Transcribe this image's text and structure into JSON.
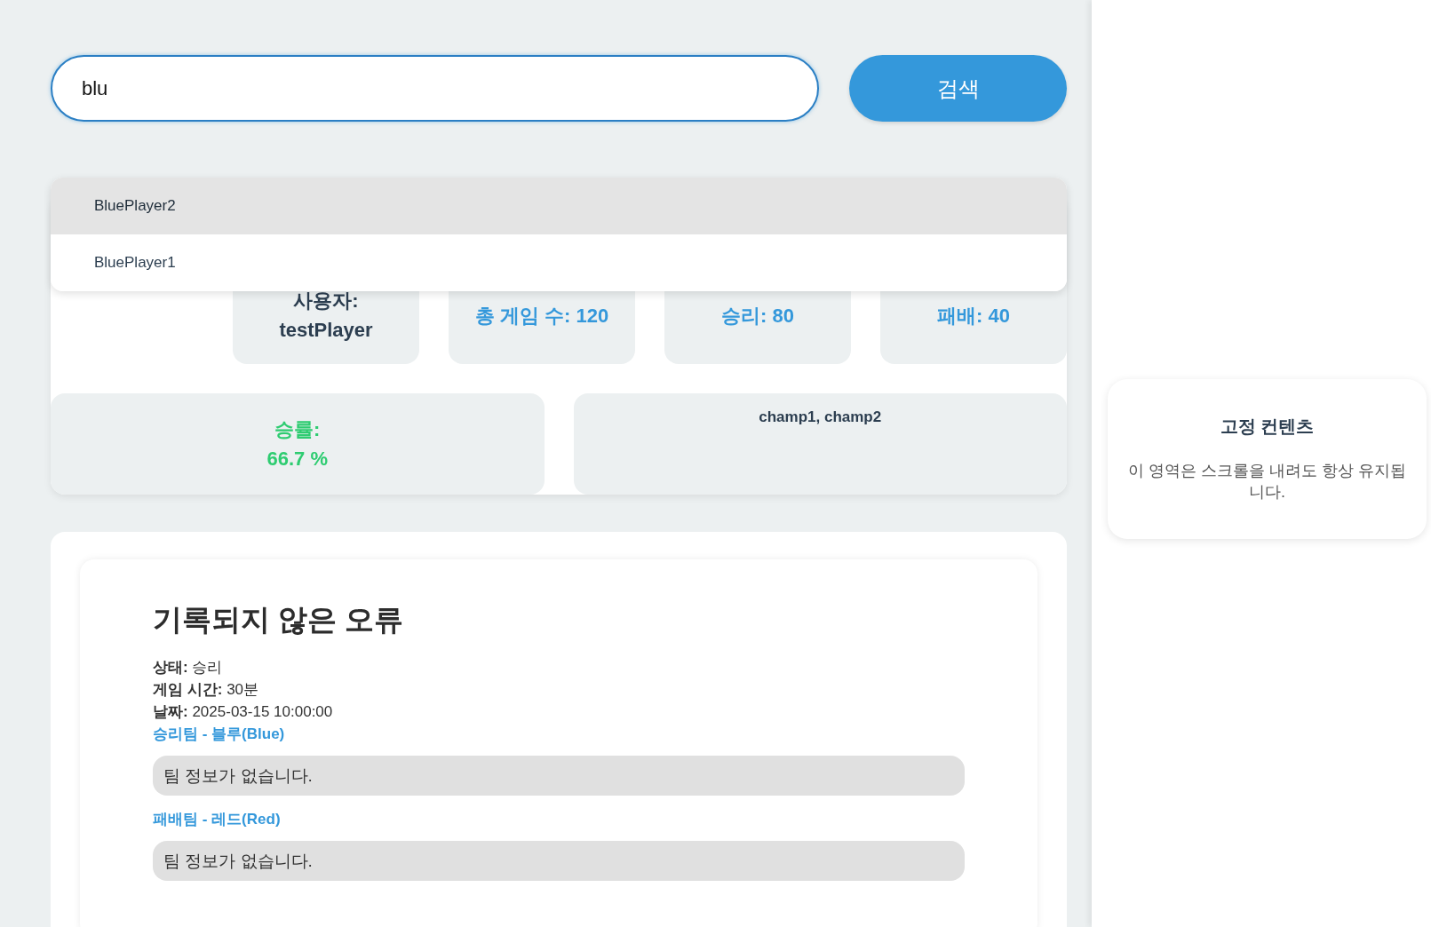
{
  "search": {
    "value": "blu",
    "button": "검색"
  },
  "suggestions": [
    {
      "label": "BluePlayer2",
      "selected": true
    },
    {
      "label": "BluePlayer1",
      "selected": false
    }
  ],
  "stats": [
    {
      "lines": [
        "사용자:",
        "testPlayer"
      ],
      "color": "#2c3e50"
    },
    {
      "lines": [
        "총 게임 수: 120"
      ],
      "color": "#3498db"
    },
    {
      "lines": [
        "승리: 80"
      ],
      "color": "#3498db"
    },
    {
      "lines": [
        "패배: 40"
      ],
      "color": "#3498db"
    }
  ],
  "summary": [
    {
      "kind": "stat",
      "lines": [
        "승률:",
        "66.7 %"
      ],
      "color": "#2ecc71"
    },
    {
      "kind": "list",
      "lines": [
        "champ1, champ2"
      ],
      "color": "#2c3e50"
    }
  ],
  "match": {
    "title": "기록되지 않은 오류",
    "fields": [
      {
        "label": "상태:",
        "value": "승리"
      },
      {
        "label": "게임 시간:",
        "value": "30분"
      },
      {
        "label": "날짜:",
        "value": "2025-03-15 10:00:00"
      }
    ],
    "teams": [
      {
        "heading": "승리팀 - 블루(Blue)",
        "info": "팀 정보가 없습니다."
      },
      {
        "heading": "패배팀 - 레드(Red)",
        "info": "팀 정보가 없습니다."
      }
    ]
  },
  "sidebar": {
    "title": "고정 컨텐츠",
    "text": "이 영역은 스크롤을 내려도 항상 유지됩니다."
  }
}
